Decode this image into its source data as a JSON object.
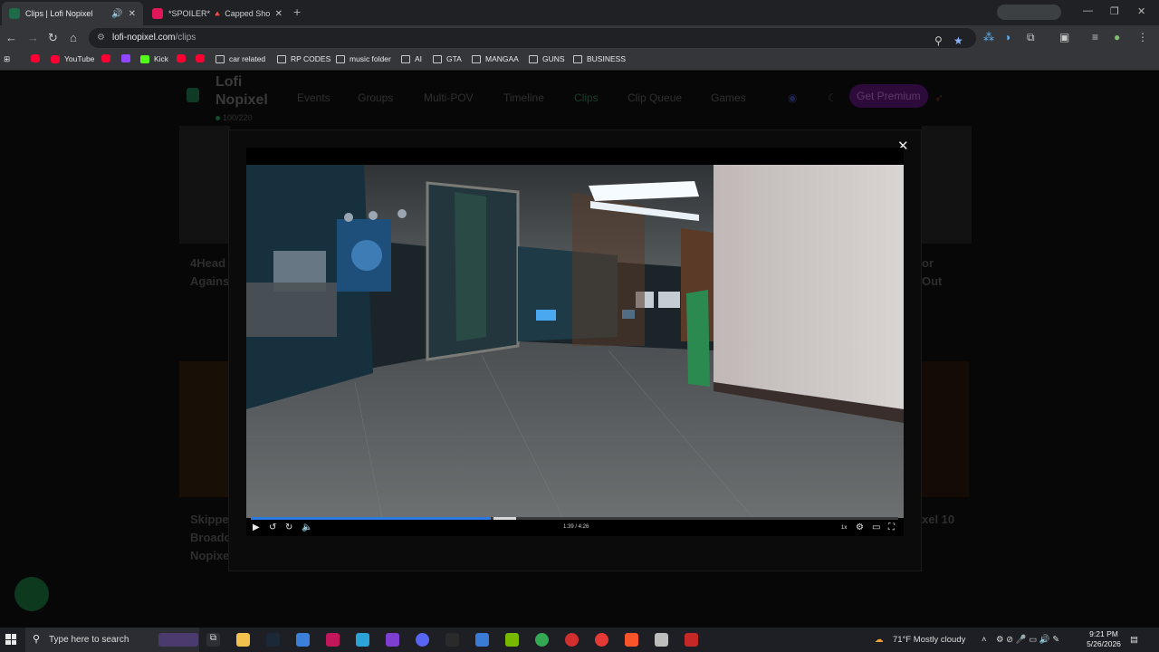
{
  "tabs": [
    {
      "title": "Clips | Lofi Nopixel",
      "active": true
    },
    {
      "title": "*SPOILER* 🔺 Capped Shows N",
      "active": false
    }
  ],
  "address": {
    "host": "lofi-nopixel.com",
    "path": "/clips"
  },
  "bookmarks": [
    "YouTube",
    "Kick",
    "car related",
    "RP CODES",
    "music folder",
    "AI",
    "GTA",
    "MANGAA",
    "GUNS",
    "BUSINESS"
  ],
  "site": {
    "brand": "Lofi Nopixel",
    "counter_value": "100",
    "counter_total": "/220",
    "nav": [
      "Events",
      "Groups",
      "Multi-POV",
      "Timeline",
      "Clips",
      "Clip Queue",
      "Games"
    ],
    "premium_label": "Get Premium",
    "background_titles": [
      "4Head Agains",
      "Out",
      "or",
      "Skippe Broadc Nopixe",
      "xel 10"
    ]
  },
  "player": {
    "time": "1:39 / 4:26",
    "progress": 0.37,
    "buffer_start": 0.375,
    "buffer_end": 0.41,
    "speed_label": "1x"
  },
  "taskbar": {
    "search_placeholder": "Type here to search",
    "weather": "71°F  Mostly cloudy",
    "time": "9:21 PM",
    "date": "5/26/2026"
  },
  "colors": {
    "accent": "#2c7be5",
    "chrome": "#35363a",
    "premium": "#6a1b8a"
  }
}
